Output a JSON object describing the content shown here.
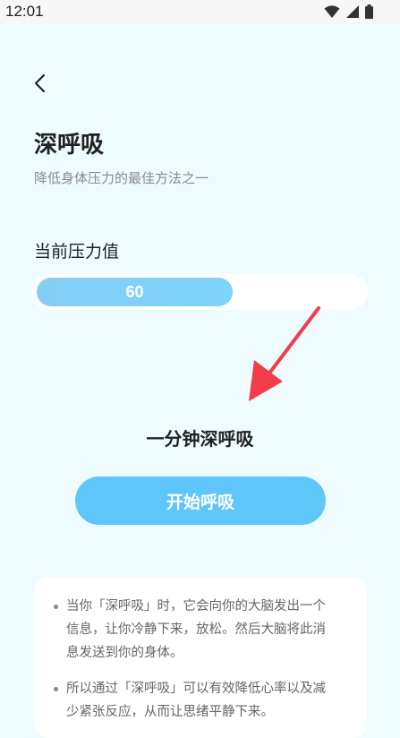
{
  "status_bar": {
    "time": "12:01"
  },
  "header": {
    "title": "深呼吸",
    "subtitle": "降低身体压力的最佳方法之一"
  },
  "stress": {
    "label": "当前压力值",
    "value": "60",
    "fill_fraction": 0.6
  },
  "breathing": {
    "title": "一分钟深呼吸",
    "start_label": "开始呼吸"
  },
  "info": {
    "items": [
      {
        "text": "当你「深呼吸」时，它会向你的大脑发出一个信息，让你冷静下来，放松。然后大脑将此消息发送到你的身体。"
      },
      {
        "text": "所以通过「深呼吸」可以有效降低心率以及减少紧张反应，从而让思绪平静下来。"
      }
    ]
  },
  "colors": {
    "background": "#eefcff",
    "accent": "#5ec6fa",
    "arrow": "#f23c4a"
  }
}
